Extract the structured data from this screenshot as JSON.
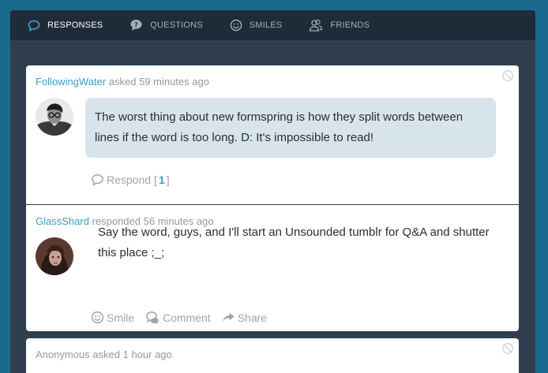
{
  "nav": {
    "responses": "RESPONSES",
    "questions": "QUESTIONS",
    "smiles": "SMILES",
    "friends": "FRIENDS"
  },
  "posts": [
    {
      "user": "FollowingWater",
      "verb": "asked",
      "time": "59 minutes ago",
      "text": "The worst thing about new formspring is how they split words between lines if the word is too long. D: It's impossible to read!",
      "respond_label": "Respond",
      "respond_open": "[",
      "respond_count": "1",
      "respond_close": "]"
    },
    {
      "user": "GlassShard",
      "verb": "responded",
      "time": "56 minutes ago",
      "text": "Say the word, guys, and I'll start an Unsounded tumblr for Q&A and shutter this place ;_;",
      "smile_label": "Smile",
      "comment_label": "Comment",
      "share_label": "Share"
    },
    {
      "user": "Anonymous",
      "verb": "asked",
      "time": "1 hour ago"
    }
  ],
  "colors": {
    "accent": "#3a9ec8",
    "bubble": "#d7e4ec",
    "nav_bg": "#1f2c38",
    "page_bg": "#1a6a8e"
  }
}
